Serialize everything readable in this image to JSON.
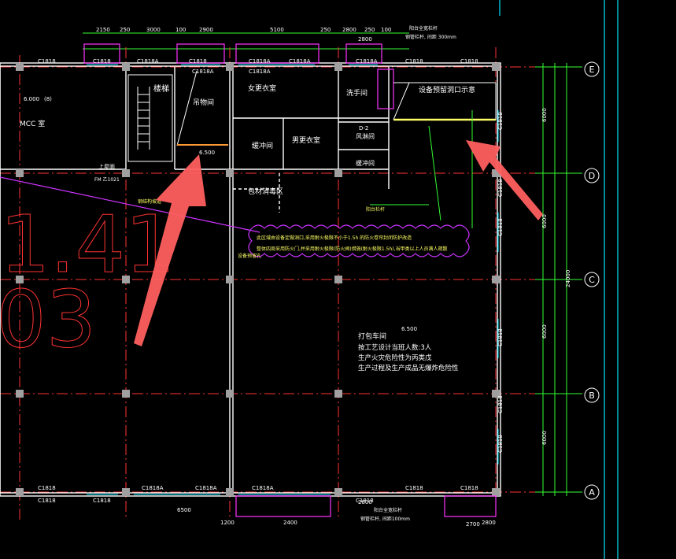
{
  "grid_axes": {
    "rows": [
      "E",
      "D",
      "C",
      "B",
      "A"
    ],
    "row_spacings_right": [
      "6000",
      "6000",
      "6000",
      "6000"
    ],
    "total_right": "24000"
  },
  "rooms": {
    "stair": "楼梯",
    "mcc_label": "MCC 室",
    "mcc_level": "6.000",
    "mcc_note": "(8)",
    "hoist": "吊物间",
    "women_change": "女更衣室",
    "men_change": "男更衣室",
    "corridor": "缓冲间",
    "wash": "洗手间",
    "air_shower_1": "风淋间",
    "air_shower_2": "缓冲间",
    "air_shower_tag": "D-2",
    "equipment": "设备预留洞口示意",
    "packing_zone": "包材消毒区",
    "workshop_title": "打包车间",
    "workshop_level": "6.500",
    "workshop_line1": "按工艺设计当班人数:3人",
    "workshop_line2": "生产火灾危险性为丙类戊",
    "workshop_line3": "生产过程及生产成品无爆炸危险性"
  },
  "notes": {
    "cloud_line1": "此区域由设备定做洞口,采用耐火极限不小于1.5h 的防火卷帘封闭防护改造",
    "cloud_line2": "整体四周采用防火门,并采用耐火极限(防火阀)措施(耐火极限1.5h),当甲类以上人员满人疏散",
    "cloud_tag": "设备预留孔",
    "ramp_note": "钢结构坡道",
    "level_mark": "6.500",
    "dock_note": "阳台栏杆",
    "pipe_note_top": "阳台全宽栏杆",
    "pipe_note_sub": "钢管栏杆, 间距 300mm",
    "bottom_note": "阳台全宽栏杆",
    "bottom_sub": "钢管栏杆, 间距100mm",
    "stair_note": "上屋面",
    "door_note_left": "FM 乙1021",
    "big_text": "1.41",
    "big_text_2": "03"
  },
  "windows": {
    "top": [
      "C1818",
      "C1818",
      "C1818A",
      "C1818A",
      "C1818",
      "C1818A",
      "C1818A",
      "C1818A",
      "C1818A",
      "C1818",
      "C1818"
    ],
    "bottom": [
      "C1818",
      "C1818",
      "C1818",
      "C1818A",
      "C1818A",
      "C1818A",
      "C1818",
      "C1818",
      "C1818"
    ],
    "right": [
      "C1818",
      "C1818",
      "C1818",
      "C1818",
      "C1818",
      "C1818"
    ]
  },
  "dims_top": [
    "2150",
    "250",
    "3000",
    "100",
    "2900",
    "5100",
    "250",
    "2800",
    "250",
    "2800",
    "100"
  ],
  "dims_bottom": [
    "1200",
    "6500",
    "2400",
    "2800",
    "2700",
    "2800"
  ],
  "colors": {
    "background": "#000000",
    "wall": "#ffffff",
    "axis_grid": "#ff3333",
    "dimension": "#33ff33",
    "arrow": "#ff6666",
    "cloud": "#cc33ff",
    "window": "#ff33ff",
    "column": "#a0a0a0"
  }
}
